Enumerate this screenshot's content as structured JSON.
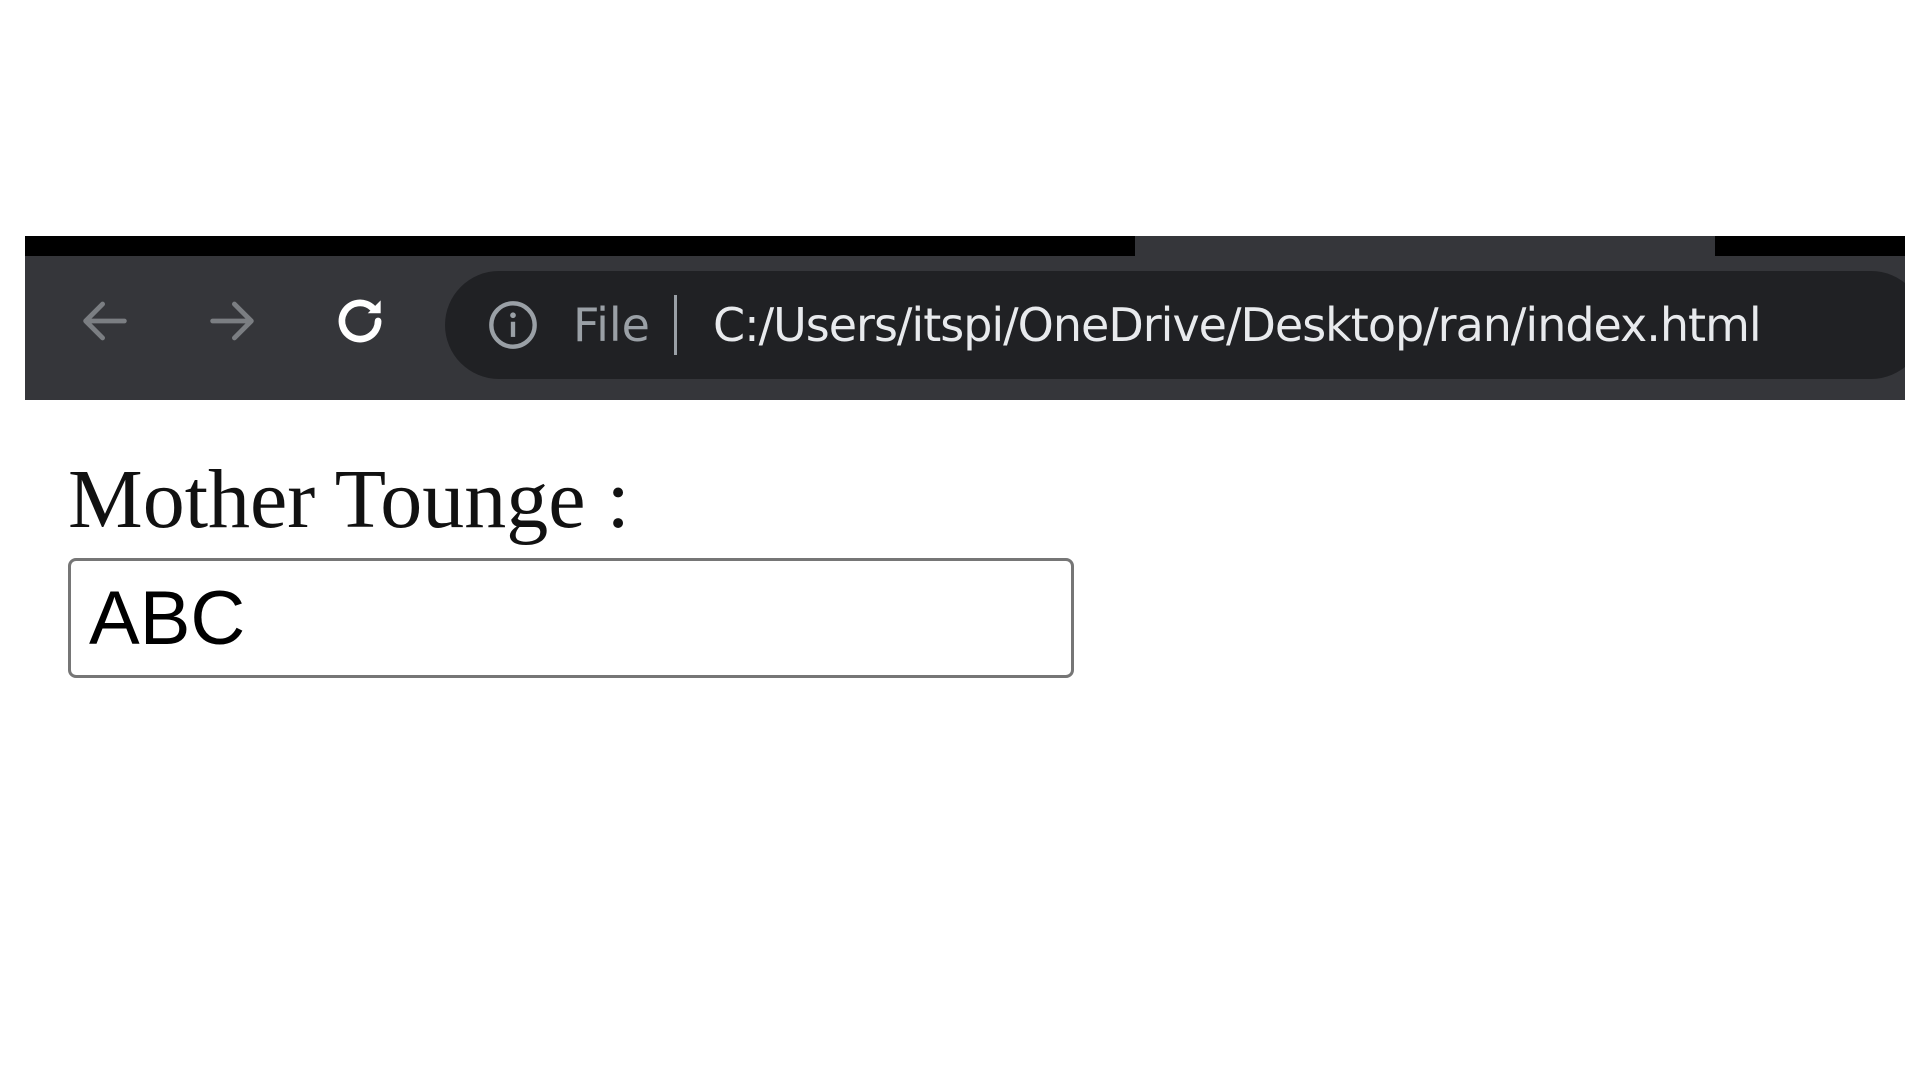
{
  "browser": {
    "address_bar": {
      "scheme_label": "File",
      "url": "C:/Users/itspi/OneDrive/Desktop/ran/index.html"
    },
    "icons": {
      "back": "arrow-left-icon",
      "forward": "arrow-right-icon",
      "reload": "reload-icon",
      "site_info": "info-icon"
    },
    "colors": {
      "chrome_dark": "#35363a",
      "omnibox_bg": "#202124",
      "tab_strip": "#000000",
      "url_text": "#e8eaed",
      "muted_text": "#9aa0a6"
    }
  },
  "form": {
    "label": "Mother Tounge :",
    "input_value": "ABC"
  }
}
